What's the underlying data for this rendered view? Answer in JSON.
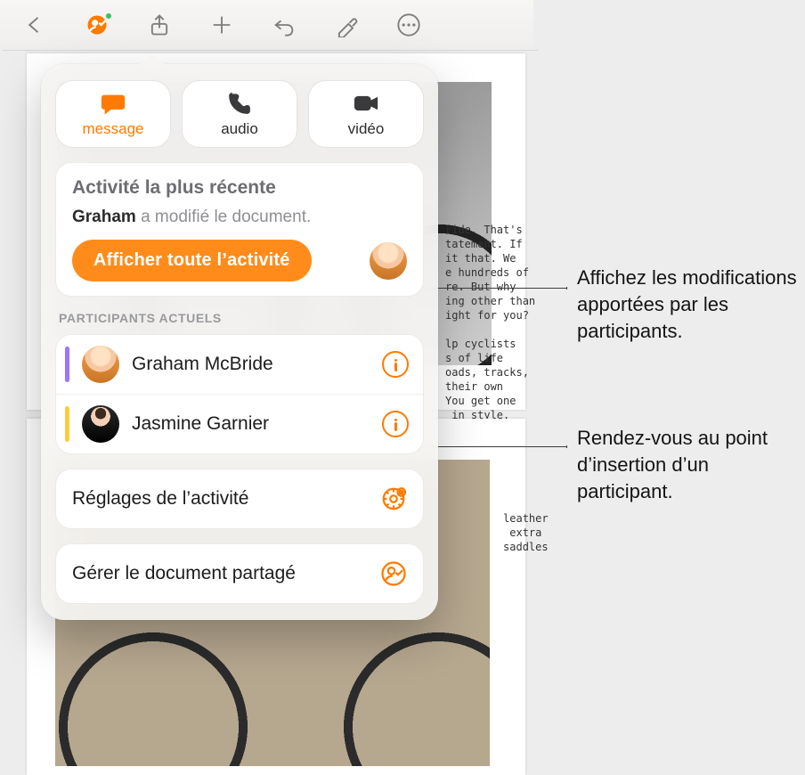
{
  "toolbar": {
    "back": "Retour",
    "collab": "Collaboration",
    "share": "Partager",
    "add": "Ajouter",
    "undo": "Annuler",
    "format": "Format",
    "more": "Plus"
  },
  "contact": {
    "message": "message",
    "audio": "audio",
    "video": "vidéo"
  },
  "activity": {
    "heading": "Activité la plus récente",
    "actor": "Graham",
    "action": " a modifié le document.",
    "show_all": "Afficher toute l’activité"
  },
  "participants": {
    "heading": "PARTICIPANTS ACTUELS",
    "list": [
      {
        "name": "Graham McBride",
        "color": "#a074ff"
      },
      {
        "name": "Jasmine Garnier",
        "color": "#ffcb3d"
      }
    ]
  },
  "options": {
    "activity_settings": "Réglages de l’activité",
    "manage_shared": "Gérer le document partagé"
  },
  "callouts": {
    "c1": "Affichez les modifications apportées par les participants.",
    "c2": "Rendez-vous au point d’insertion d’un participant."
  },
  "bg_text": {
    "block1": "ride. That's\ntatement. If\nit that. We\ne hundreds of\nre. But why\ning other than\night for you?\n\nlp cyclists\ns of life\noads, tracks,\ntheir own\nYou get one\n in style.",
    "block2": "DDLE //\normance, leather\npadded to extra\nifferent saddles"
  }
}
